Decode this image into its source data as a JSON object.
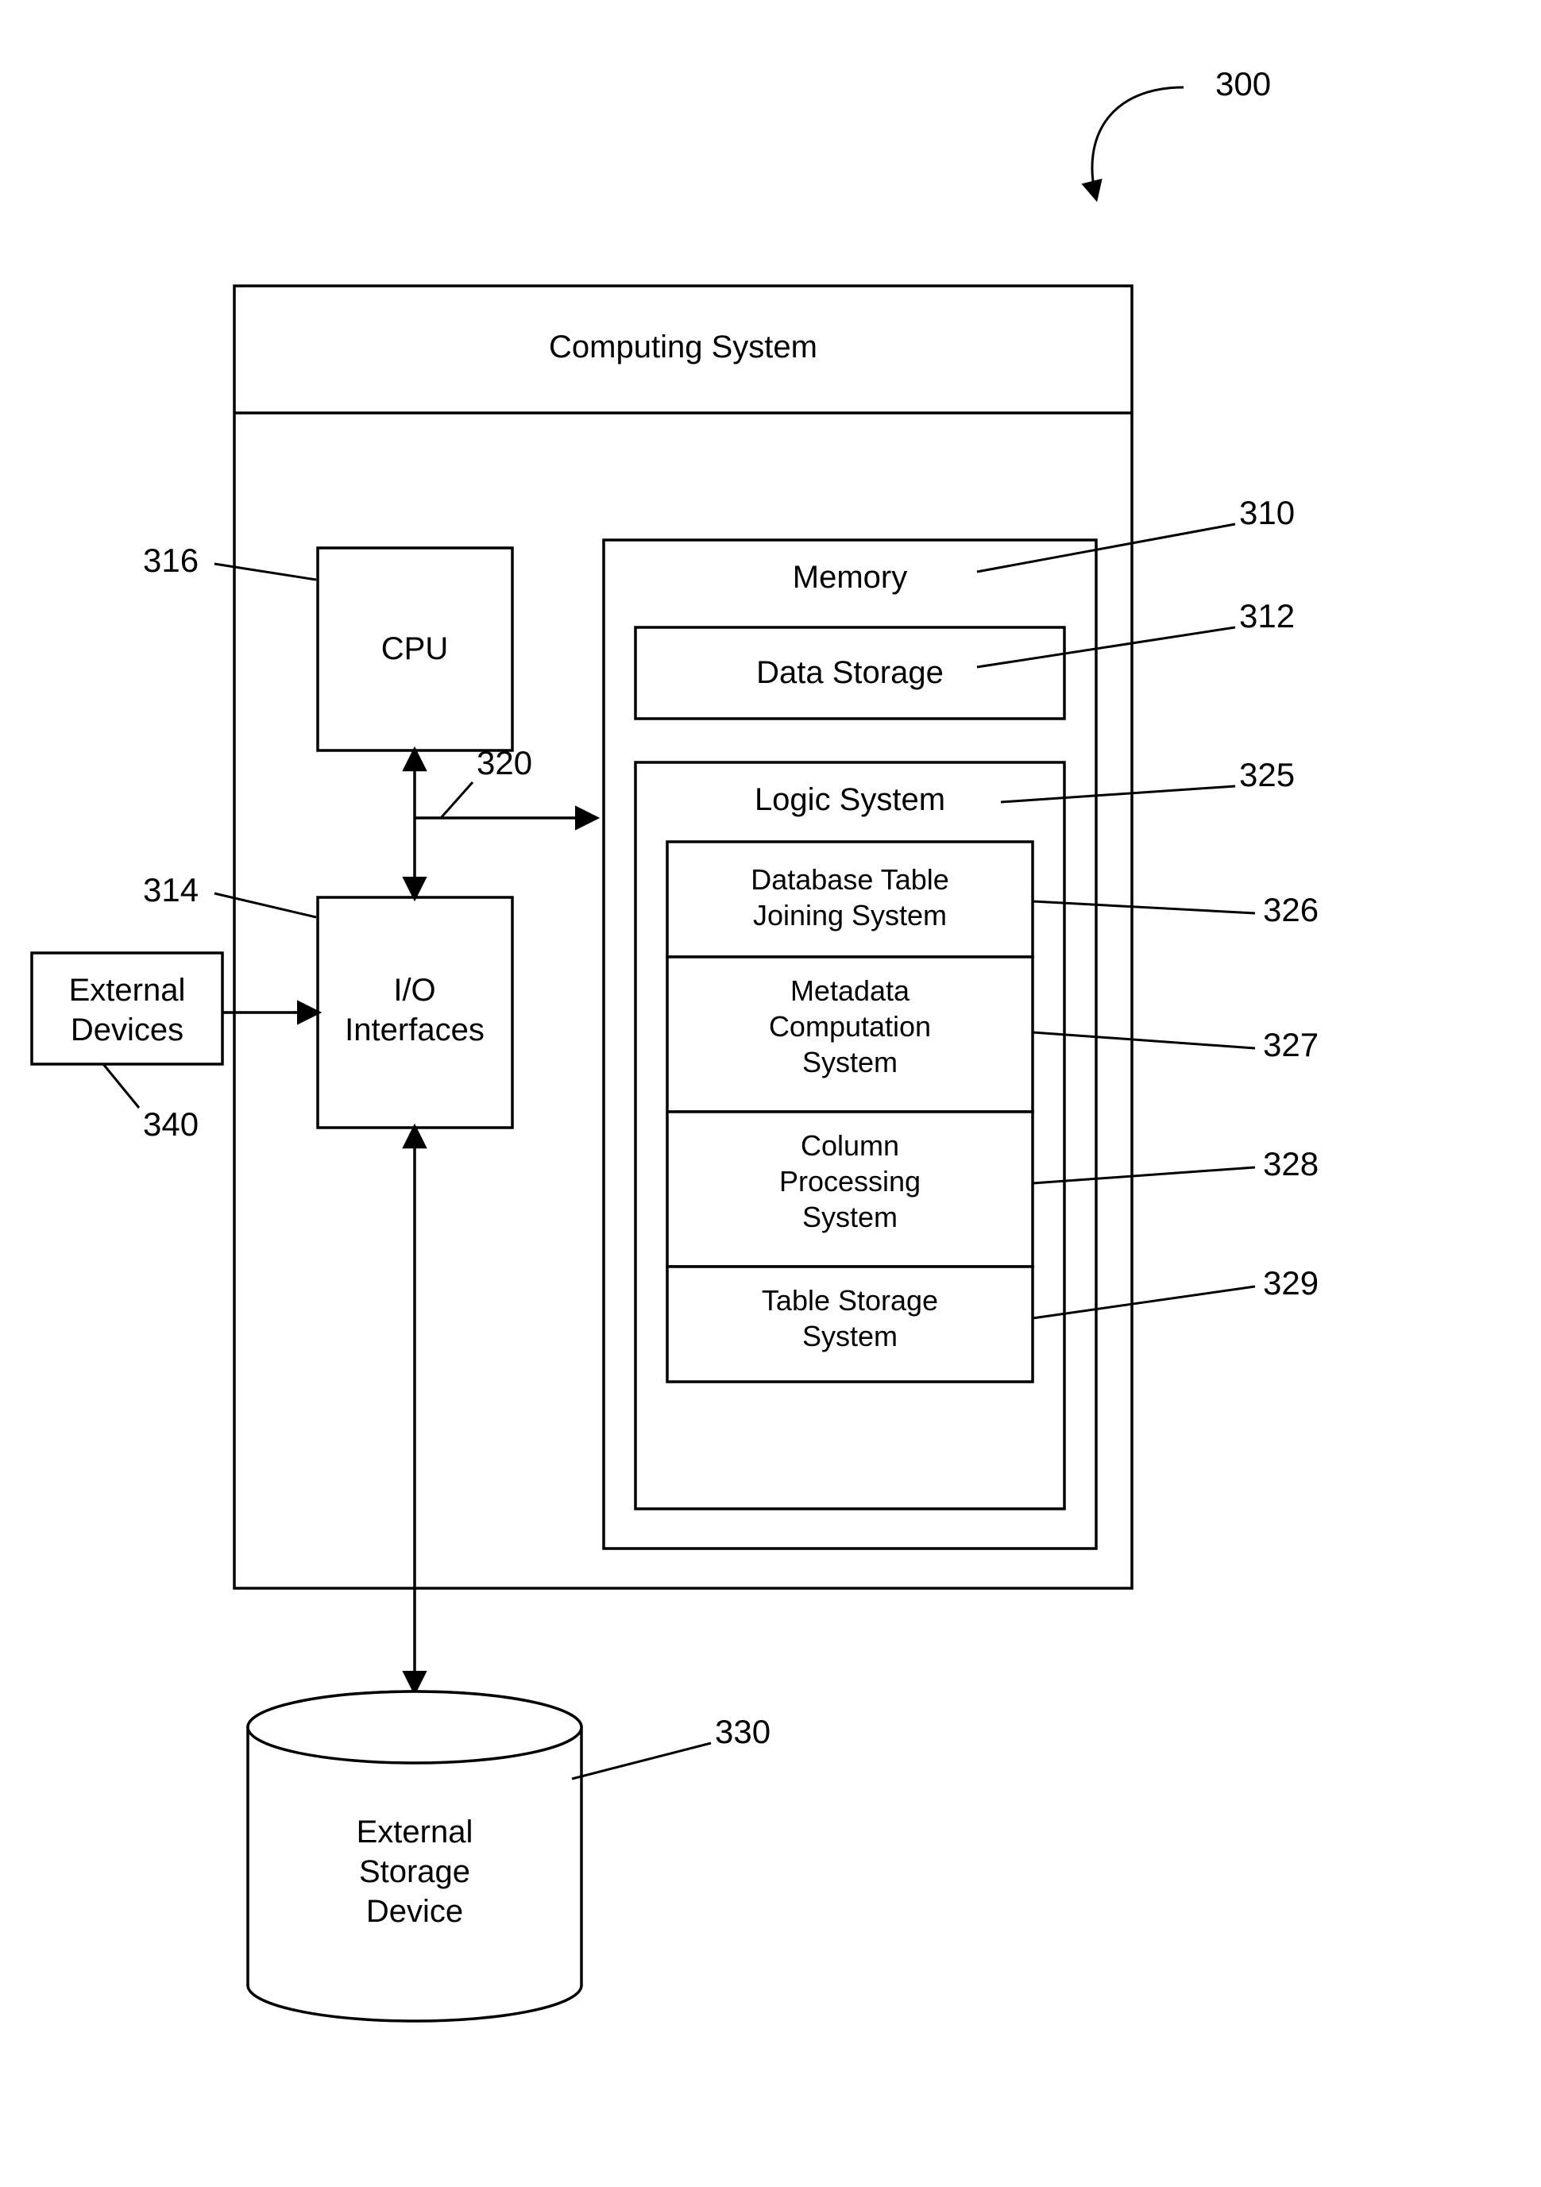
{
  "diagram": {
    "refnum_main": "300",
    "computing_system": {
      "title": "Computing System",
      "cpu": {
        "label": "CPU",
        "refnum": "316"
      },
      "io": {
        "label_line1": "I/O",
        "label_line2": "Interfaces",
        "refnum": "314"
      },
      "bus_refnum": "320",
      "memory": {
        "title": "Memory",
        "refnum": "310",
        "data_storage": {
          "label": "Data Storage",
          "refnum": "312"
        },
        "logic_system": {
          "title": "Logic System",
          "refnum": "325",
          "items": [
            {
              "line1": "Database Table",
              "line2": "Joining System",
              "refnum": "326"
            },
            {
              "line1": "Metadata",
              "line2": "Computation",
              "line3": "System",
              "refnum": "327"
            },
            {
              "line1": "Column",
              "line2": "Processing",
              "line3": "System",
              "refnum": "328"
            },
            {
              "line1": "Table Storage",
              "line2": "System",
              "refnum": "329"
            }
          ]
        }
      }
    },
    "external_devices": {
      "line1": "External",
      "line2": "Devices",
      "refnum": "340"
    },
    "external_storage": {
      "line1": "External",
      "line2": "Storage",
      "line3": "Device",
      "refnum": "330"
    }
  }
}
